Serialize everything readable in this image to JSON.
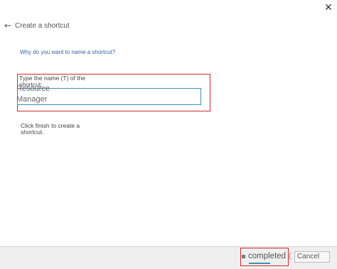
{
  "window": {
    "close_label": "✕"
  },
  "header": {
    "back_icon": "←",
    "title": "Create a shortcut"
  },
  "question": "Why do you want to name a shortcut?",
  "field": {
    "label_main": "Type the name (T) of the",
    "label_second": "shortcut:",
    "value": "Resource\nManager"
  },
  "instruction": "Click finish to create a shortcut.",
  "footer": {
    "finish_label": "completed",
    "finish_paren": "(",
    "cancel_label": "Cancel"
  },
  "colors": {
    "accent": "#3c8fb3",
    "highlight": "#cc2a2a",
    "link": "#3b5fa6"
  }
}
